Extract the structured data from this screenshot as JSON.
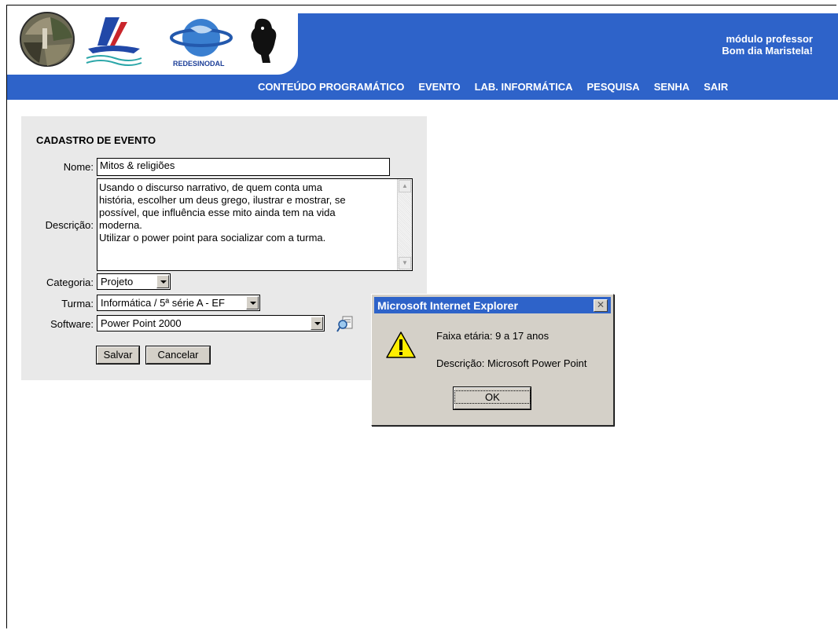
{
  "header": {
    "module_label": "módulo professor",
    "greeting": "Bom dia Maristela!",
    "logo_text": "REDESINODAL"
  },
  "nav": {
    "items": [
      "CONTEÚDO PROGRAMÁTICO",
      "EVENTO",
      "LAB. INFORMÁTICA",
      "PESQUISA",
      "SENHA",
      "SAIR"
    ]
  },
  "form": {
    "title": "CADASTRO DE EVENTO",
    "nome_label": "Nome:",
    "nome_value": "Mitos & religiões",
    "descricao_label": "Descrição:",
    "descricao_value": "Usando o discurso narrativo, de quem conta uma\nhistória, escolher um deus grego, ilustrar e mostrar, se\npossível, que influência esse mito ainda tem na vida\nmoderna.\nUtilizar o power point para socializar com a turma.",
    "categoria_label": "Categoria:",
    "categoria_value": "Projeto",
    "turma_label": "Turma:",
    "turma_value": "Informática / 5ª série A - EF",
    "software_label": "Software:",
    "software_value": "Power Point 2000",
    "save_label": "Salvar",
    "cancel_label": "Cancelar"
  },
  "dialog": {
    "title": "Microsoft Internet Explorer",
    "close": "✕",
    "line1": "Faixa etária: 9 a 17 anos",
    "line2": "Descrição: Microsoft Power Point",
    "ok_label": "OK"
  },
  "colors": {
    "header_blue": "#2e63c9",
    "panel_gray": "#e9e9e9",
    "dialog_face": "#d4d0c8"
  }
}
